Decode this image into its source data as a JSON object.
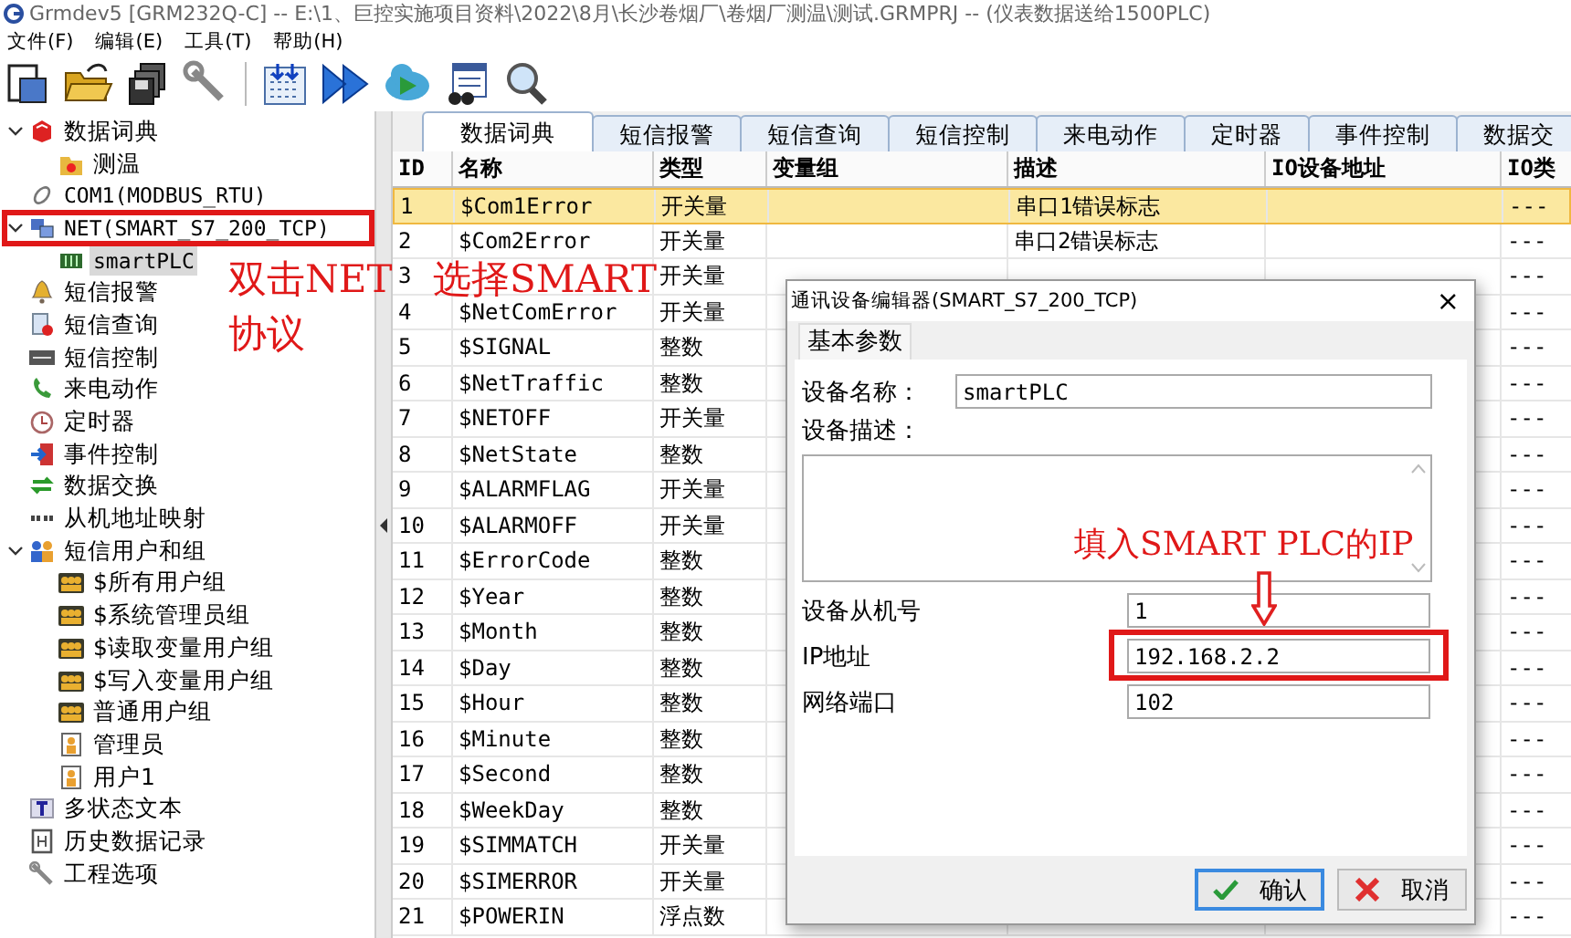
{
  "window": {
    "title": "Grmdev5 [GRM232Q-C]  -- E:\\1、巨控实施项目资料\\2022\\8月\\长沙卷烟厂\\卷烟厂测温\\测试.GRMPRJ -- (仪表数据送给1500PLC)"
  },
  "menu": [
    {
      "label": "文件(F)"
    },
    {
      "label": "编辑(E)"
    },
    {
      "label": "工具(T)"
    },
    {
      "label": "帮助(H)"
    }
  ],
  "tree": [
    {
      "label": "数据词典",
      "kind": "book",
      "expanded": true,
      "selected": false,
      "children": [
        {
          "label": "测温",
          "kind": "folder",
          "selected": false
        }
      ]
    },
    {
      "label": "COM1(MODBUS_RTU)",
      "kind": "plug",
      "selected": false
    },
    {
      "label": "NET(SMART_S7_200_TCP)",
      "kind": "network",
      "expanded": true,
      "selected": false,
      "highlighted": true,
      "children": [
        {
          "label": "smartPLC",
          "kind": "chip",
          "selected": true
        }
      ]
    },
    {
      "label": "短信报警",
      "kind": "bell",
      "selected": false
    },
    {
      "label": "短信查询",
      "kind": "query",
      "selected": false
    },
    {
      "label": "短信控制",
      "kind": "keyboard",
      "selected": false
    },
    {
      "label": "来电动作",
      "kind": "phone",
      "selected": false
    },
    {
      "label": "定时器",
      "kind": "clock",
      "selected": false
    },
    {
      "label": "事件控制",
      "kind": "event",
      "selected": false
    },
    {
      "label": "数据交换",
      "kind": "swap",
      "selected": false
    },
    {
      "label": "从机地址映射",
      "kind": "binary",
      "selected": false
    },
    {
      "label": "短信用户和组",
      "kind": "users",
      "expanded": true,
      "selected": false,
      "children": [
        {
          "label": "$所有用户组",
          "kind": "group",
          "selected": false
        },
        {
          "label": "$系统管理员组",
          "kind": "group",
          "selected": false
        },
        {
          "label": "$读取变量用户组",
          "kind": "group",
          "selected": false
        },
        {
          "label": "$写入变量用户组",
          "kind": "group",
          "selected": false
        },
        {
          "label": "普通用户组",
          "kind": "group",
          "selected": false
        },
        {
          "label": "管理员",
          "kind": "user",
          "selected": false
        },
        {
          "label": "用户1",
          "kind": "user",
          "selected": false
        }
      ]
    },
    {
      "label": "多状态文本",
      "kind": "text",
      "selected": false
    },
    {
      "label": "历史数据记录",
      "kind": "log",
      "selected": false
    },
    {
      "label": "工程选项",
      "kind": "wrench",
      "selected": false
    }
  ],
  "tabs": [
    {
      "label": "数据词典",
      "selected": true
    },
    {
      "label": "短信报警",
      "selected": false
    },
    {
      "label": "短信查询",
      "selected": false
    },
    {
      "label": "短信控制",
      "selected": false
    },
    {
      "label": "来电动作",
      "selected": false
    },
    {
      "label": "定时器",
      "selected": false
    },
    {
      "label": "事件控制",
      "selected": false
    },
    {
      "label": "数据交",
      "selected": false
    }
  ],
  "table": {
    "columns": [
      "ID",
      "名称",
      "类型",
      "变量组",
      "描述",
      "IO设备地址",
      "IO类"
    ],
    "rows": [
      {
        "id": "1",
        "name": "$Com1Error",
        "type": "开关量",
        "description": "串口1错误标志",
        "io_type": "---",
        "selected": true
      },
      {
        "id": "2",
        "name": "$Com2Error",
        "type": "开关量",
        "description": "串口2错误标志",
        "io_type": "---",
        "selected": false
      },
      {
        "id": "3",
        "type": "开关量",
        "io_type": "---",
        "selected": false
      },
      {
        "id": "4",
        "name": "$NetComError",
        "type": "开关量",
        "io_type": "---",
        "selected": false
      },
      {
        "id": "5",
        "name": "$SIGNAL",
        "type": "整数",
        "io_type": "---",
        "selected": false
      },
      {
        "id": "6",
        "name": "$NetTraffic",
        "type": "整数",
        "io_type": "---",
        "selected": false
      },
      {
        "id": "7",
        "name": "$NETOFF",
        "type": "开关量",
        "io_type": "---",
        "selected": false
      },
      {
        "id": "8",
        "name": "$NetState",
        "type": "整数",
        "io_type": "---",
        "selected": false
      },
      {
        "id": "9",
        "name": "$ALARMFLAG",
        "type": "开关量",
        "io_type": "---",
        "selected": false
      },
      {
        "id": "10",
        "name": "$ALARMOFF",
        "type": "开关量",
        "io_type": "---",
        "selected": false
      },
      {
        "id": "11",
        "name": "$ErrorCode",
        "type": "整数",
        "io_type": "---",
        "selected": false
      },
      {
        "id": "12",
        "name": "$Year",
        "type": "整数",
        "io_type": "---",
        "selected": false
      },
      {
        "id": "13",
        "name": "$Month",
        "type": "整数",
        "io_type": "---",
        "selected": false
      },
      {
        "id": "14",
        "name": "$Day",
        "type": "整数",
        "io_type": "---",
        "selected": false
      },
      {
        "id": "15",
        "name": "$Hour",
        "type": "整数",
        "io_type": "---",
        "selected": false
      },
      {
        "id": "16",
        "name": "$Minute",
        "type": "整数",
        "io_type": "---",
        "selected": false
      },
      {
        "id": "17",
        "name": "$Second",
        "type": "整数",
        "io_type": "---",
        "selected": false
      },
      {
        "id": "18",
        "name": "$WeekDay",
        "type": "整数",
        "io_type": "---",
        "selected": false
      },
      {
        "id": "19",
        "name": "$SIMMATCH",
        "type": "开关量",
        "io_type": "---",
        "selected": false
      },
      {
        "id": "20",
        "name": "$SIMERROR",
        "type": "开关量",
        "io_type": "---",
        "selected": false
      },
      {
        "id": "21",
        "name": "$POWERIN",
        "type": "浮点数",
        "io_type": "---",
        "selected": false
      }
    ]
  },
  "annotation_left": [
    "双击NET",
    "选择SMART",
    "协议"
  ],
  "dialog": {
    "title": "通讯设备编辑器(SMART_S7_200_TCP)",
    "close": "×",
    "tab": "基本参数",
    "name_label": "设备名称：",
    "name_value": "smartPLC",
    "description_label": "设备描述：",
    "fields": [
      {
        "label": "设备从机号",
        "value": "1",
        "highlighted": false
      },
      {
        "label": "IP地址",
        "value": "192.168.2.2",
        "highlighted": true
      },
      {
        "label": "网络端口",
        "value": "102",
        "highlighted": false
      }
    ],
    "annotation": "填入SMART PLC的IP",
    "buttons": [
      {
        "label": "确认",
        "kind": "ok"
      },
      {
        "label": "取消",
        "kind": "cancel"
      }
    ]
  }
}
